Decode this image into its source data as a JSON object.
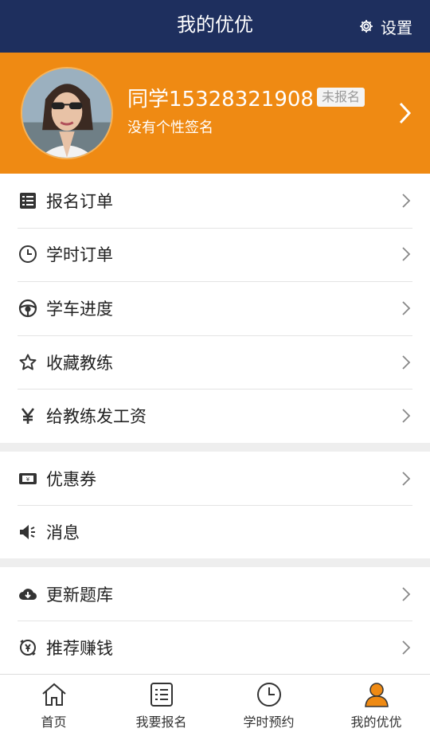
{
  "header": {
    "title": "我的优优",
    "settings_label": "设置"
  },
  "profile": {
    "name": "同学15328321908",
    "badge": "未报名",
    "signature": "没有个性签名"
  },
  "menu_group_1": [
    {
      "label": "报名订单",
      "icon": "list-icon"
    },
    {
      "label": "学时订单",
      "icon": "clock-icon"
    },
    {
      "label": "学车进度",
      "icon": "steering-wheel-icon"
    },
    {
      "label": "收藏教练",
      "icon": "star-icon"
    },
    {
      "label": "给教练发工资",
      "icon": "yen-icon"
    }
  ],
  "menu_group_2": [
    {
      "label": "优惠券",
      "icon": "coupon-icon"
    },
    {
      "label": "消息",
      "icon": "speaker-icon"
    }
  ],
  "menu_group_3": [
    {
      "label": "更新题库",
      "icon": "cloud-download-icon"
    },
    {
      "label": "推荐赚钱",
      "icon": "recommend-money-icon"
    }
  ],
  "tabbar": [
    {
      "label": "首页",
      "icon": "home-icon"
    },
    {
      "label": "我要报名",
      "icon": "list-icon"
    },
    {
      "label": "学时预约",
      "icon": "clock-icon"
    },
    {
      "label": "我的优优",
      "icon": "user-icon",
      "active": true
    }
  ],
  "colors": {
    "header_bg": "#1e2f5e",
    "profile_bg": "#ef8a13",
    "active_tab": "#ef8a13"
  }
}
